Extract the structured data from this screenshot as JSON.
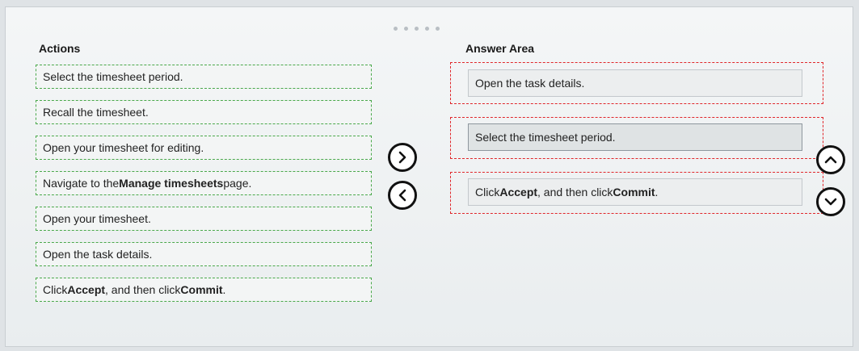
{
  "carousel": {
    "dot_count": 5
  },
  "actions_panel": {
    "heading": "Actions",
    "items": [
      {
        "parts": [
          "Select the timesheet period.",
          "",
          ""
        ]
      },
      {
        "parts": [
          "Recall the timesheet.",
          "",
          ""
        ]
      },
      {
        "parts": [
          "Open your timesheet for editing.",
          "",
          ""
        ]
      },
      {
        "parts": [
          "Navigate to the ",
          "Manage timesheets",
          " page."
        ]
      },
      {
        "parts": [
          "Open your timesheet.",
          "",
          ""
        ]
      },
      {
        "parts": [
          "Open the task details.",
          "",
          ""
        ]
      },
      {
        "parts": [
          "Click ",
          "Accept",
          ", and then click "
        ],
        "tail_bold": "Commit",
        "tail": "."
      }
    ]
  },
  "answer_area": {
    "heading": "Answer Area",
    "items": [
      {
        "parts": [
          "Open the task details.",
          "",
          ""
        ]
      },
      {
        "parts": [
          "Select the timesheet period.",
          "",
          ""
        ]
      },
      {
        "parts": [
          "Click ",
          "Accept",
          ", and then click "
        ],
        "tail_bold": "Commit",
        "tail": "."
      }
    ]
  },
  "icons": {
    "move_right": "chevron-right-icon",
    "move_left": "chevron-left-icon",
    "move_up": "chevron-up-icon",
    "move_down": "chevron-down-icon"
  }
}
